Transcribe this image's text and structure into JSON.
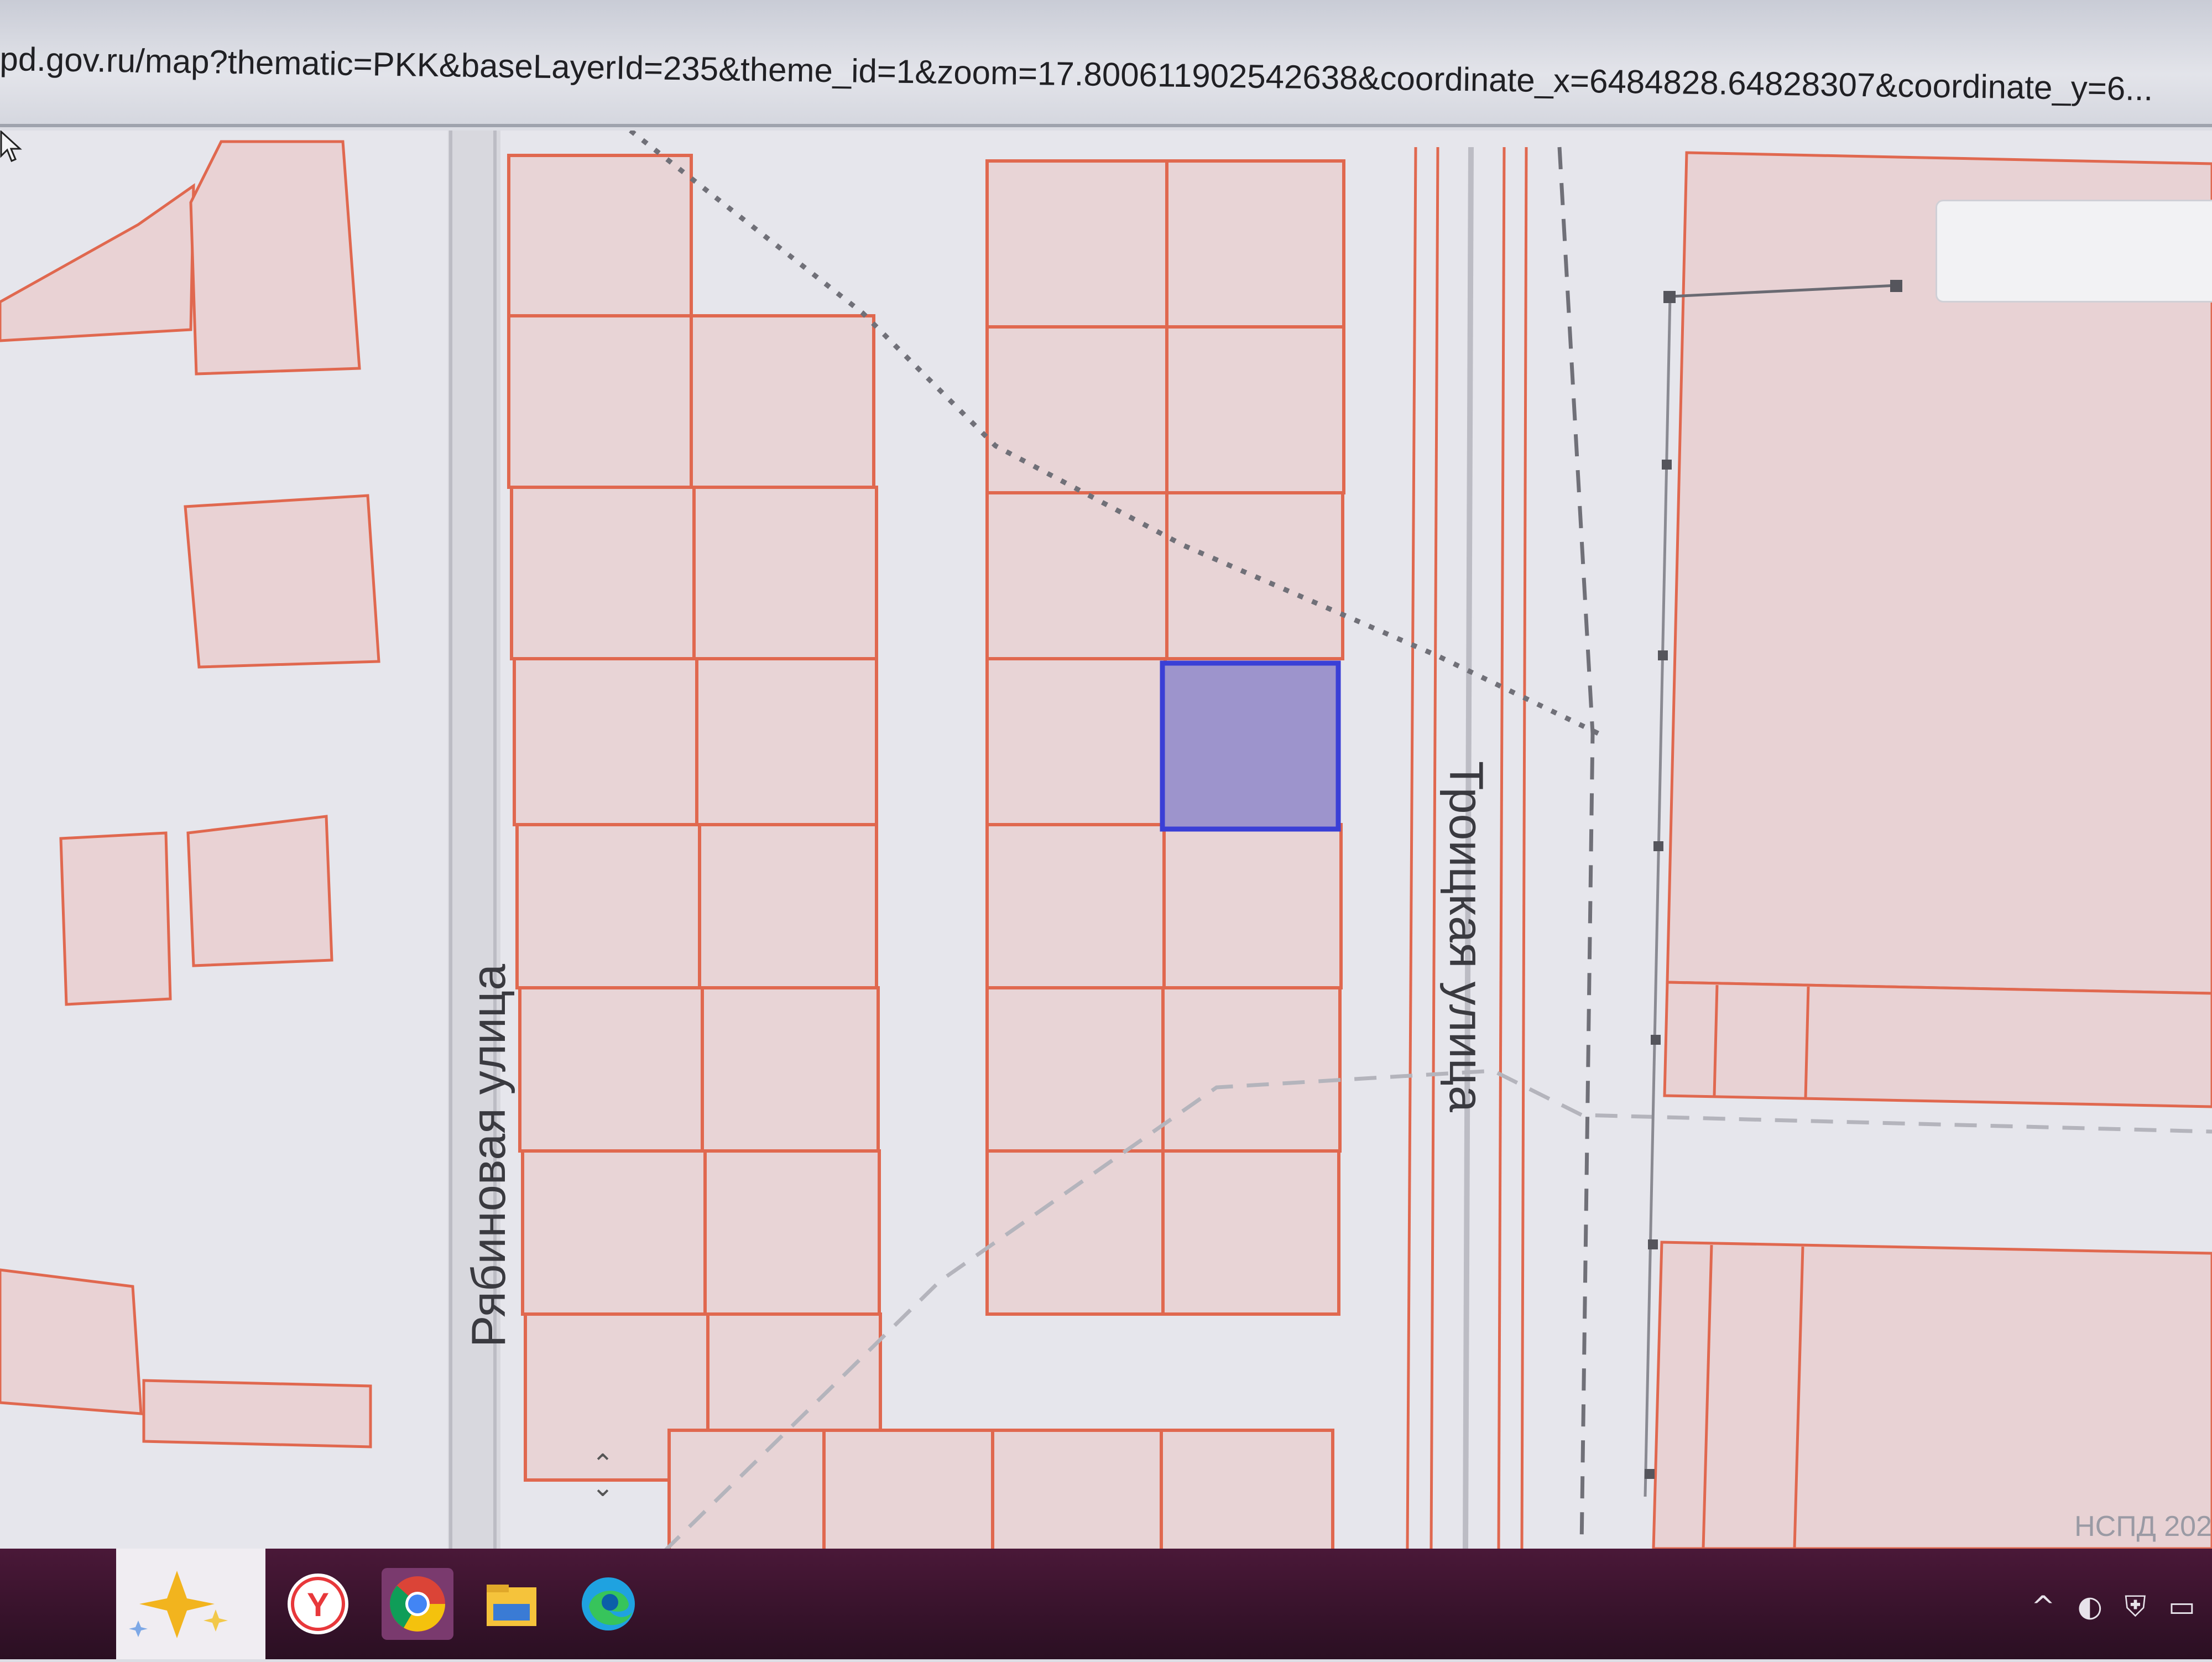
{
  "browser": {
    "url": "pd.gov.ru/map?thematic=PKK&baseLayerId=235&theme_id=1&zoom=17.800611902542638&coordinate_x=6484828.64828307&coordinate_y=6..."
  },
  "map": {
    "streets": [
      {
        "name": "Рябиновая  улица"
      },
      {
        "name": "Троицкая  улица"
      }
    ],
    "attribution": "НСПД 202",
    "colors": {
      "parcel_border": "#e0684f",
      "parcel_fill": "#e9d2d4",
      "selected_border": "#3a3fd6",
      "selected_fill": "#9d94cc",
      "boundary_dotted": "#707078"
    },
    "zoom_handle_icon": "chevron-up-down-icon",
    "cursor_icon": "mouse-pointer-icon"
  },
  "taskbar": {
    "apps": [
      {
        "name": "ai-sparkle-icon"
      },
      {
        "name": "yandex-browser-icon"
      },
      {
        "name": "chrome-icon"
      },
      {
        "name": "file-explorer-icon"
      },
      {
        "name": "edge-icon"
      }
    ],
    "tray": {
      "up_arrow": "^"
    }
  }
}
